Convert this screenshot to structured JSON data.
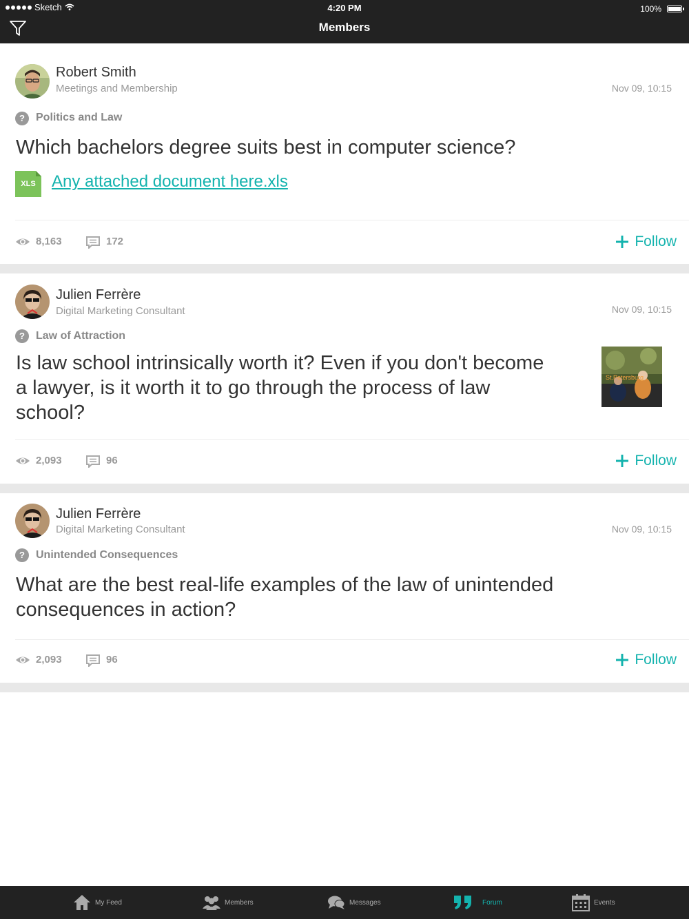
{
  "status_bar": {
    "carrier": "Sketch",
    "time": "4:20 PM",
    "battery": "100%"
  },
  "header": {
    "title": "Members",
    "filter_icon": "filter-icon"
  },
  "posts": [
    {
      "author": "Robert Smith",
      "role": "Meetings and Membership",
      "time": "Nov 09, 10:15",
      "category": "Politics and Law",
      "question": "Which bachelors degree suits best in computer science?",
      "attachment": {
        "type_label": "XLS",
        "name": "Any attached document here.xls"
      },
      "views": "8,163",
      "comments": "172",
      "follow_label": "Follow"
    },
    {
      "author": "Julien Ferrère",
      "role": "Digital Marketing Consultant",
      "time": "Nov 09, 10:15",
      "category": "Law of Attraction",
      "question": "Is law school intrinsically worth it? Even if you don't become a lawyer, is it worth it to go through the process of law school?",
      "thumbnail_text": "St.Petersburg",
      "views": "2,093",
      "comments": "96",
      "follow_label": "Follow"
    },
    {
      "author": "Julien Ferrère",
      "role": "Digital Marketing Consultant",
      "time": "Nov 09, 10:15",
      "category": "Unintended Consequences",
      "question": "What are the best real-life examples of the law of unintended consequences in action?",
      "views": "2,093",
      "comments": "96",
      "follow_label": "Follow"
    }
  ],
  "tabs": [
    {
      "label": "My Feed",
      "icon": "home-icon"
    },
    {
      "label": "Members",
      "icon": "members-icon"
    },
    {
      "label": "Messages",
      "icon": "messages-icon"
    },
    {
      "label": "Forum",
      "icon": "quote-icon",
      "active": true
    },
    {
      "label": "Events",
      "icon": "calendar-icon"
    }
  ],
  "colors": {
    "accent": "#14b3ae",
    "bar": "#222222",
    "xls": "#7cc35a"
  }
}
